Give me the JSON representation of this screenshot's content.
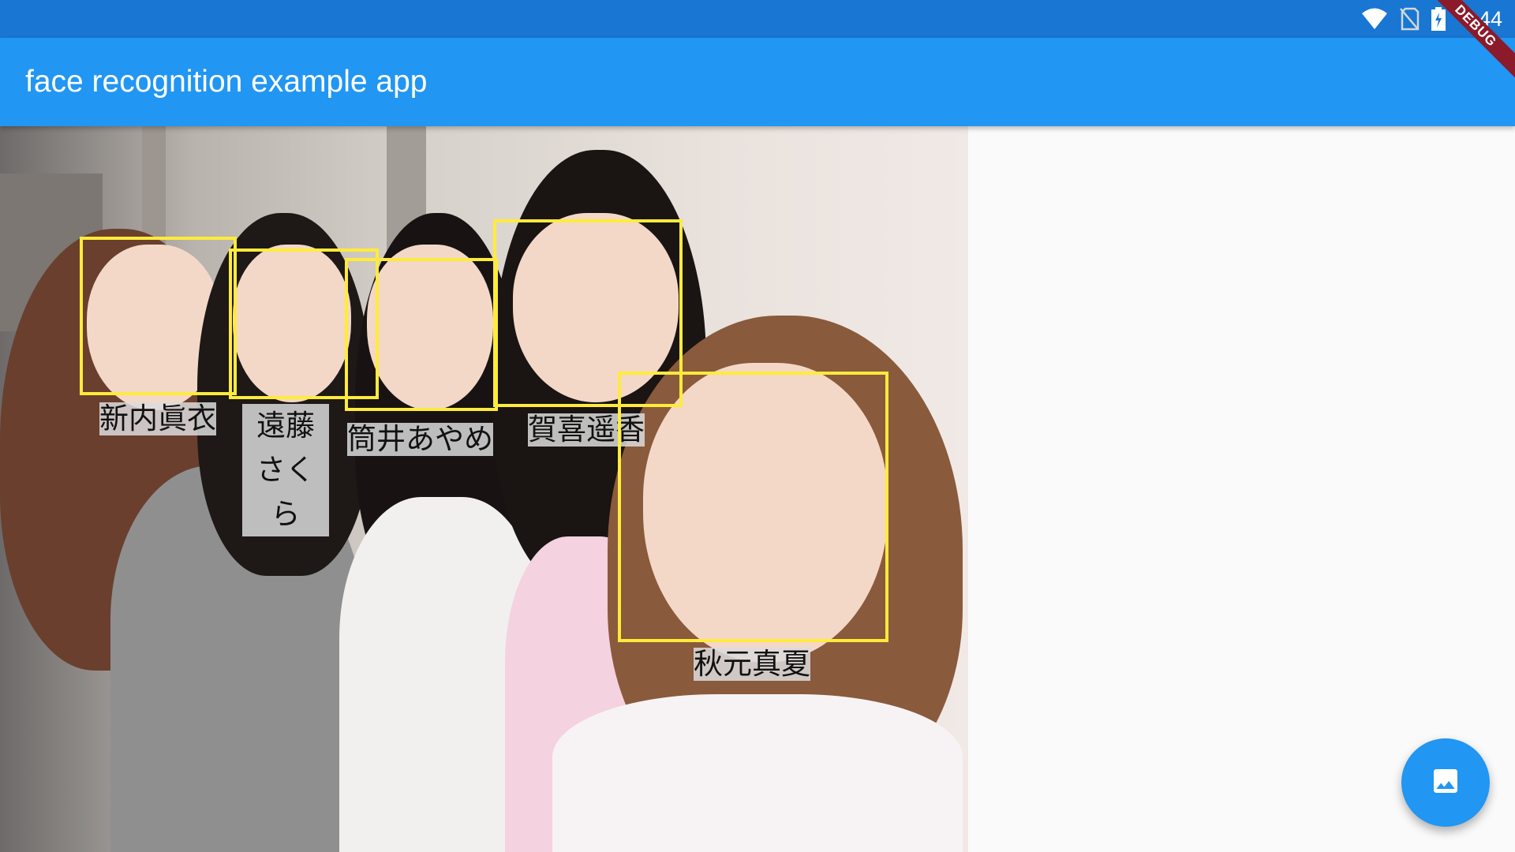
{
  "status_bar": {
    "time": "4:44",
    "icons": [
      "wifi-icon",
      "no-sim-icon",
      "battery-charging-icon"
    ]
  },
  "app_bar": {
    "title": "face recognition example app"
  },
  "debug_banner": {
    "label": "DEBUG"
  },
  "faces": [
    {
      "name": "新内眞衣"
    },
    {
      "name": "遠藤さくら"
    },
    {
      "name": "筒井あやめ"
    },
    {
      "name": "賀喜遥香"
    },
    {
      "name": "秋元真夏"
    }
  ],
  "fab": {
    "icon": "image-icon"
  },
  "colors": {
    "status_bar": "#1976d2",
    "app_bar": "#2196f3",
    "box": "#ffeb3b",
    "background": "#fafafa"
  }
}
